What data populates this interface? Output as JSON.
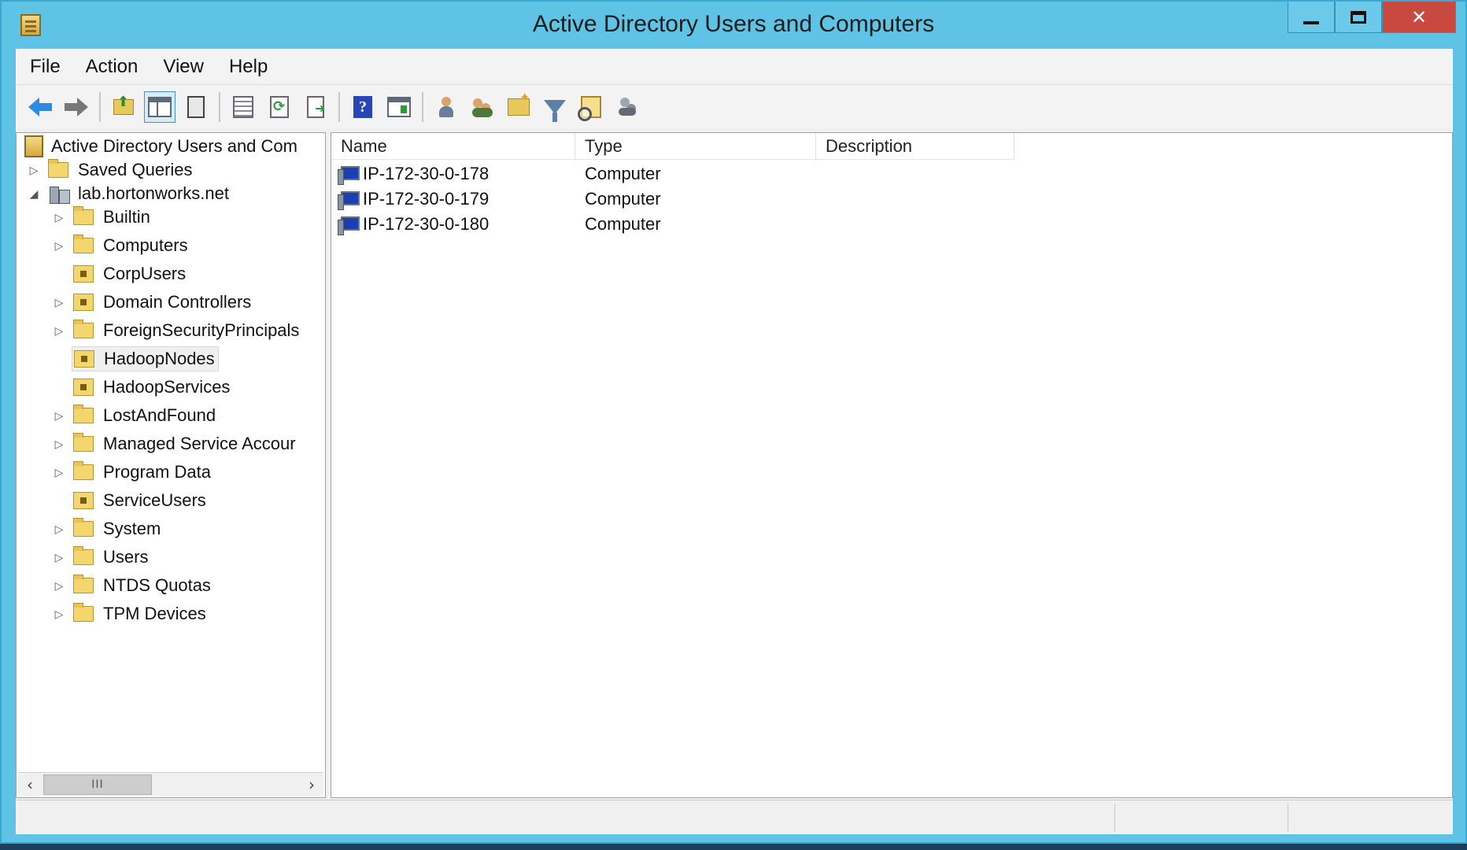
{
  "window": {
    "title": "Active Directory Users and Computers"
  },
  "menu": [
    "File",
    "Action",
    "View",
    "Help"
  ],
  "toolbar": {
    "icons": [
      "back-icon",
      "forward-icon",
      "up-one-level-icon",
      "show-hide-console-tree-icon",
      "paste-icon",
      "properties-icon",
      "refresh-icon",
      "export-list-icon",
      "help-icon",
      "show-hide-action-pane-icon",
      "create-user-icon",
      "create-group-icon",
      "create-ou-icon",
      "filter-icon",
      "find-icon",
      "delegate-control-icon"
    ]
  },
  "tree": {
    "root": "Active Directory Users and Com",
    "saved_queries": "Saved Queries",
    "domain": "lab.hortonworks.net",
    "items": [
      {
        "label": "Builtin",
        "kind": "folder",
        "expandable": true
      },
      {
        "label": "Computers",
        "kind": "folder",
        "expandable": true
      },
      {
        "label": "CorpUsers",
        "kind": "ou",
        "expandable": false
      },
      {
        "label": "Domain Controllers",
        "kind": "ou",
        "expandable": true
      },
      {
        "label": "ForeignSecurityPrincipals",
        "kind": "folder",
        "expandable": true
      },
      {
        "label": "HadoopNodes",
        "kind": "ou",
        "expandable": false,
        "selected": true
      },
      {
        "label": "HadoopServices",
        "kind": "ou",
        "expandable": false
      },
      {
        "label": "LostAndFound",
        "kind": "folder",
        "expandable": true
      },
      {
        "label": "Managed Service Accour",
        "kind": "folder",
        "expandable": true
      },
      {
        "label": "Program Data",
        "kind": "folder",
        "expandable": true
      },
      {
        "label": "ServiceUsers",
        "kind": "ou",
        "expandable": false
      },
      {
        "label": "System",
        "kind": "folder",
        "expandable": true
      },
      {
        "label": "Users",
        "kind": "folder",
        "expandable": true
      },
      {
        "label": "NTDS Quotas",
        "kind": "folder",
        "expandable": true
      },
      {
        "label": "TPM Devices",
        "kind": "folder",
        "expandable": true
      }
    ],
    "scroll_thumb": "III"
  },
  "list": {
    "columns": [
      "Name",
      "Type",
      "Description"
    ],
    "rows": [
      {
        "name": "IP-172-30-0-178",
        "type": "Computer",
        "description": ""
      },
      {
        "name": "IP-172-30-0-179",
        "type": "Computer",
        "description": ""
      },
      {
        "name": "IP-172-30-0-180",
        "type": "Computer",
        "description": ""
      }
    ]
  },
  "colors": {
    "titlebar": "#5fc3e6",
    "close_button": "#c9483f",
    "help_icon": "#2846b8"
  }
}
